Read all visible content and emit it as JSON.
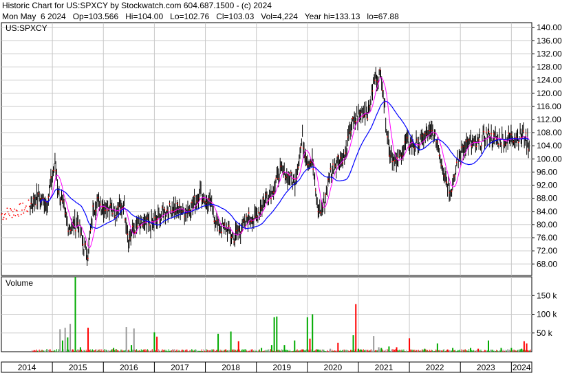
{
  "header": {
    "line1": "Historic Chart for US:SPXCY by Stockwatch.com 604.687.1500 - (c) 2024",
    "line2": "Mon May  6 2024   Op=103.566   Hi=104.00   Lo=102.76   Cl=103.03   Vol=4,224   Year hi=133.13   lo=67.88"
  },
  "colors": {
    "price_bars": "#000000",
    "recent_points": "#ff0000",
    "ma_short": "#ff00ff",
    "ma_long": "#0000ff",
    "vol_up": "#00aa00",
    "vol_down": "#ff0000",
    "vol_flat": "#999999",
    "grid": "#c8c8c8"
  },
  "chart_data": [
    {
      "type": "line",
      "panel": "price",
      "label": "US:SPXCY",
      "y_ticks": [
        "140.00",
        "136.00",
        "132.00",
        "128.00",
        "124.00",
        "120.00",
        "116.00",
        "112.00",
        "108.00",
        "104.00",
        "100.00",
        "96.00",
        "92.00",
        "88.00",
        "84.00",
        "80.00",
        "76.00",
        "72.00",
        "68.00"
      ],
      "ylim": [
        64.5,
        141.5
      ],
      "x_ticks": [
        "2014",
        "2015",
        "2016",
        "2017",
        "2018",
        "2019",
        "2020",
        "2021",
        "2022",
        "2023",
        "2024"
      ],
      "xlim": [
        2014.0,
        2024.4
      ],
      "series": [
        {
          "x": [
            2014.0,
            2014.5,
            2014.7,
            2014.9,
            2015.05,
            2015.1,
            2015.2,
            2015.3,
            2015.4,
            2015.5,
            2015.6,
            2015.7,
            2015.8,
            2015.9,
            2016.0,
            2016.1,
            2016.25,
            2016.4,
            2016.5,
            2016.6,
            2016.75,
            2016.9,
            2017.0,
            2017.2,
            2017.4,
            2017.6,
            2017.75,
            2017.9,
            2018.0,
            2018.1,
            2018.25,
            2018.4,
            2018.55,
            2018.7,
            2018.85,
            2019.0,
            2019.15,
            2019.3,
            2019.45,
            2019.6,
            2019.75,
            2019.9,
            2020.0,
            2020.1,
            2020.2,
            2020.3,
            2020.45,
            2020.6,
            2020.75,
            2020.85,
            2021.0,
            2021.1,
            2021.2,
            2021.3,
            2021.45,
            2021.6,
            2021.75,
            2021.9,
            2022.0,
            2022.15,
            2022.3,
            2022.45,
            2022.55,
            2022.65,
            2022.8,
            2022.95,
            2023.1,
            2023.3,
            2023.5,
            2023.7,
            2023.9,
            2024.1,
            2024.25,
            2024.35
          ],
          "y": [
            83,
            85,
            88,
            87,
            99,
            92,
            86,
            80,
            79,
            81,
            74,
            71,
            85,
            87,
            85,
            86,
            84,
            86,
            75,
            79,
            80,
            80,
            81,
            84,
            85,
            84,
            86,
            90,
            87,
            86,
            79,
            79,
            76,
            79,
            82,
            82,
            88,
            90,
            96,
            95,
            93,
            106,
            100,
            99,
            84,
            85,
            96,
            100,
            101,
            110,
            113,
            115,
            114,
            124,
            126,
            103,
            98,
            104,
            105,
            104,
            107,
            108,
            105,
            98,
            90,
            99,
            105,
            104,
            107,
            106,
            106,
            107,
            107,
            104
          ]
        }
      ]
    },
    {
      "type": "bar",
      "panel": "volume",
      "label": "Volume",
      "y_ticks": [
        "150 k",
        "100 k",
        "50 k"
      ],
      "ylim": [
        0,
        200
      ],
      "x_ticks": [
        "2014",
        "2015",
        "2016",
        "2017",
        "2018",
        "2019",
        "2020",
        "2021",
        "2022",
        "2023",
        "2024"
      ],
      "xlim": [
        2014.0,
        2024.4
      ],
      "series": [
        {
          "name": "up",
          "x": [
            2015.2,
            2015.3,
            2015.45,
            2015.55,
            2016.2,
            2016.55,
            2017.0,
            2018.25,
            2018.5,
            2019.1,
            2019.3,
            2019.35,
            2019.4,
            2019.55,
            2019.75,
            2020.0,
            2020.1,
            2020.2,
            2020.9,
            2021.0,
            2021.05,
            2021.45,
            2021.6,
            2022.3,
            2022.55,
            2022.85,
            2023.2,
            2023.55,
            2023.8,
            2024.0,
            2024.2
          ],
          "values": [
            30,
            38,
            200,
            12,
            10,
            18,
            52,
            48,
            54,
            10,
            18,
            92,
            94,
            18,
            30,
            92,
            100,
            6,
            44,
            8,
            6,
            10,
            14,
            8,
            22,
            10,
            10,
            30,
            10,
            10,
            8
          ]
        },
        {
          "name": "down",
          "x": [
            2015.4,
            2015.7,
            2016.8,
            2017.05,
            2018.4,
            2018.65,
            2019.9,
            2020.05,
            2020.6,
            2020.95,
            2021.75,
            2022.0,
            2022.75,
            2023.35,
            2024.25,
            2024.3
          ],
          "values": [
            6,
            64,
            6,
            40,
            6,
            28,
            6,
            35,
            24,
            127,
            12,
            36,
            6,
            8,
            28,
            22
          ]
        },
        {
          "name": "flat",
          "x": [
            2015.15,
            2015.25,
            2015.35,
            2015.5,
            2016.45,
            2016.6,
            2020.3,
            2020.45,
            2021.3,
            2021.4
          ],
          "values": [
            60,
            64,
            74,
            4,
            66,
            62,
            6,
            8,
            42,
            12
          ]
        }
      ]
    }
  ]
}
